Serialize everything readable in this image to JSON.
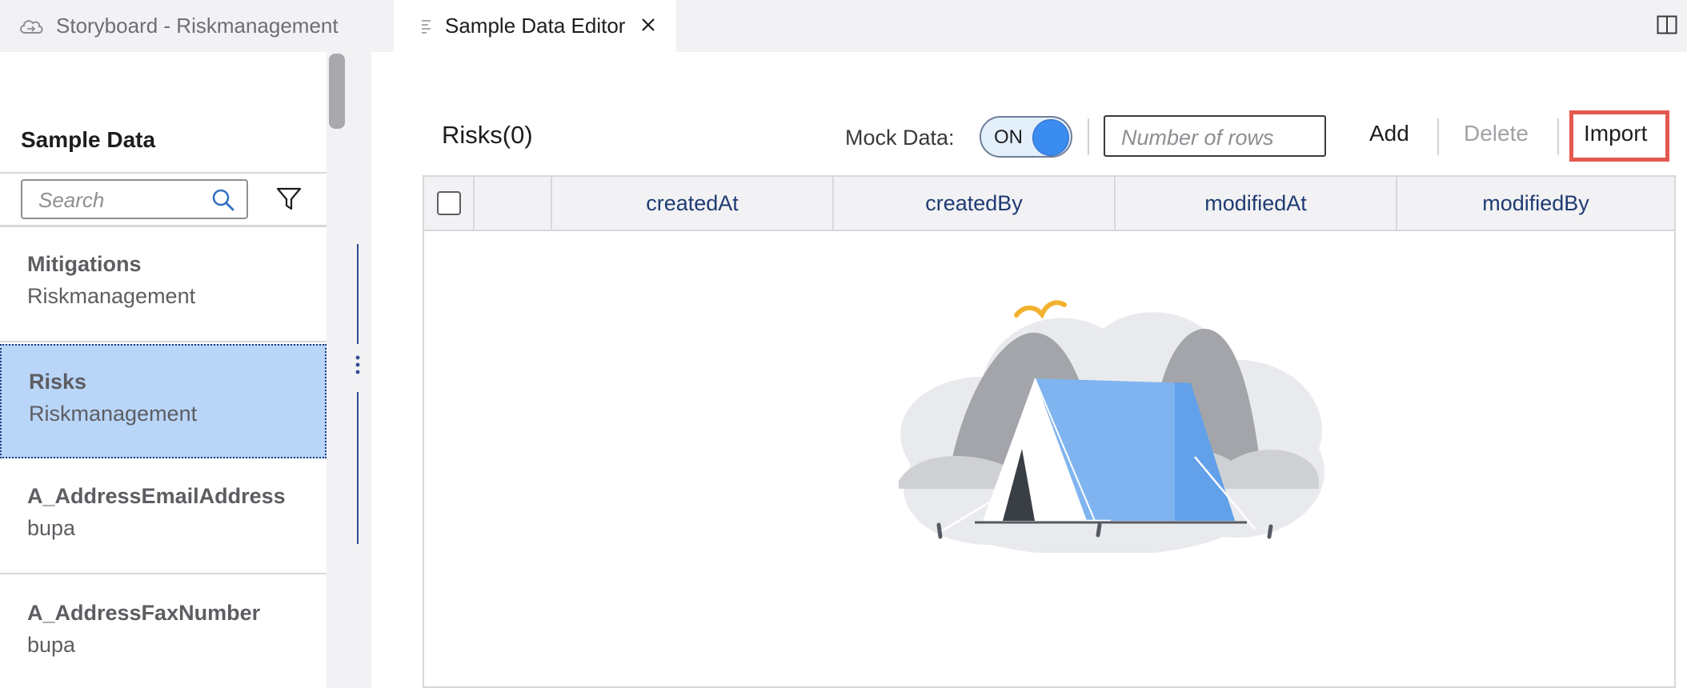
{
  "tabs": [
    {
      "label": "Storyboard - Riskmanagement",
      "icon": "cloud-icon",
      "active": false
    },
    {
      "label": "Sample Data Editor",
      "icon": "document-lines-icon",
      "active": true
    }
  ],
  "sidebar": {
    "title": "Sample Data",
    "search_placeholder": "Search",
    "items": [
      {
        "title": "Mitigations",
        "subtitle": "Riskmanagement",
        "selected": false
      },
      {
        "title": "Risks",
        "subtitle": "Riskmanagement",
        "selected": true
      },
      {
        "title": "A_AddressEmailAddress",
        "subtitle": "bupa",
        "selected": false
      },
      {
        "title": "A_AddressFaxNumber",
        "subtitle": "bupa",
        "selected": false
      }
    ]
  },
  "editor": {
    "entity_title": "Risks(0)",
    "mock_data_label": "Mock Data:",
    "mock_toggle_text": "ON",
    "rows_placeholder": "Number of rows",
    "add_label": "Add",
    "delete_label": "Delete",
    "import_label": "Import",
    "columns": [
      "createdAt",
      "createdBy",
      "modifiedAt",
      "modifiedBy"
    ]
  },
  "colors": {
    "selection_bg": "#b9d6f8",
    "toggle_knob": "#3b8cf0",
    "import_highlight": "#e4584f",
    "column_header_text": "#1f3b73"
  }
}
